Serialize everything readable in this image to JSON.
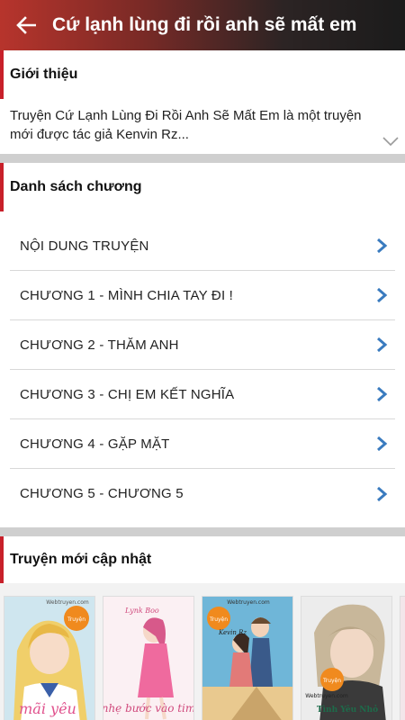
{
  "header": {
    "title": "Cứ lạnh lùng đi rồi anh sẽ mất em",
    "back_icon": "arrow-left-icon"
  },
  "intro": {
    "heading": "Giới thiệu",
    "text": "Truyện Cứ Lạnh Lùng Đi Rồi Anh Sẽ Mất Em là một truyện mới được tác giả Kenvin Rz...",
    "expand_icon": "chevron-down-icon"
  },
  "chapters": {
    "heading": "Danh sách chương",
    "items": [
      {
        "label": "NỘI DUNG TRUYỆN"
      },
      {
        "label": "CHƯƠNG 1 - MÌNH CHIA TAY ĐI !"
      },
      {
        "label": "CHƯƠNG 2 - THĂM ANH"
      },
      {
        "label": "CHƯƠNG 3 - CHỊ EM KẾT NGHĨA"
      },
      {
        "label": "CHƯƠNG 4 - GẶP MẶT"
      },
      {
        "label": "CHƯƠNG 5 - CHƯƠNG 5"
      }
    ]
  },
  "recent": {
    "heading": "Truyện mới cập nhật",
    "covers": [
      {
        "watermark": "Webtruyen.com",
        "title": "mãi yêu",
        "badge": "Truyện"
      },
      {
        "watermark": "Lynk Boo",
        "title": "nhẹ bước vào tim",
        "badge": ""
      },
      {
        "watermark": "Webtruyen.com",
        "title": "Kevin Rz",
        "badge": "Truyện"
      },
      {
        "watermark": "Webtruyen.com",
        "title": "Tình Yêu Nhỏ",
        "badge": "Truyện"
      }
    ]
  },
  "colors": {
    "accent": "#c8202a",
    "chevron": "#3a7bbf",
    "divider": "#cfcfcf"
  }
}
